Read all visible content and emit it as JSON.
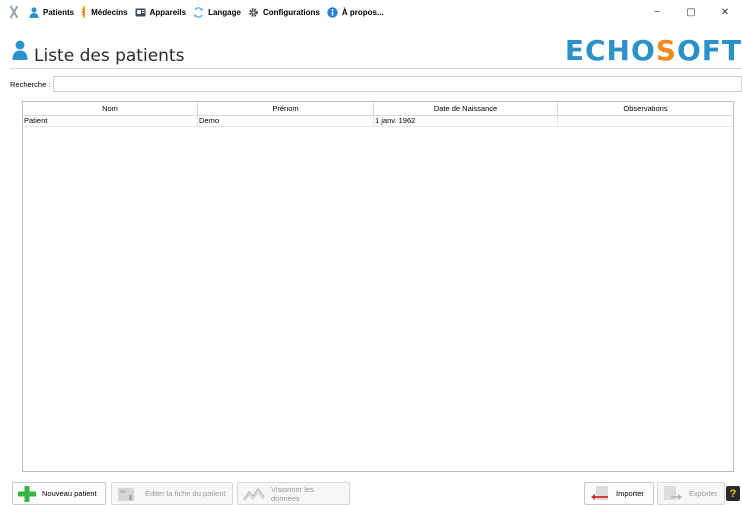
{
  "menu": {
    "items": [
      {
        "label": "Patients",
        "icon": "person-icon"
      },
      {
        "label": "Médecins",
        "icon": "doctor-icon"
      },
      {
        "label": "Appareils",
        "icon": "device-icon"
      },
      {
        "label": "Langage",
        "icon": "language-icon"
      },
      {
        "label": "Configurations",
        "icon": "gear-icon"
      },
      {
        "label": "À propos...",
        "icon": "info-icon"
      }
    ]
  },
  "window": {
    "minimize": "−",
    "maximize": "▢",
    "close": "✕"
  },
  "header": {
    "title": "Liste des patients",
    "logo_part1": "ECHO",
    "logo_s": "S",
    "logo_part2": "OFT"
  },
  "search": {
    "label": "Recherche :",
    "value": "",
    "placeholder": ""
  },
  "table": {
    "columns": [
      "Nom",
      "Prénom",
      "Date de Naissance",
      "Observations"
    ],
    "rows": [
      [
        "Patient",
        "Demo",
        "1 janv. 1962",
        ""
      ]
    ]
  },
  "buttons": {
    "new_patient": "Nouveau patient",
    "edit_patient": "Éditer la fiche du patient",
    "view_data": "Visionner les données",
    "import": "Importer",
    "export": "Exporter"
  },
  "colors": {
    "brand": "#2a92c8",
    "accent": "#f28a1c",
    "add_green": "#38b447"
  }
}
